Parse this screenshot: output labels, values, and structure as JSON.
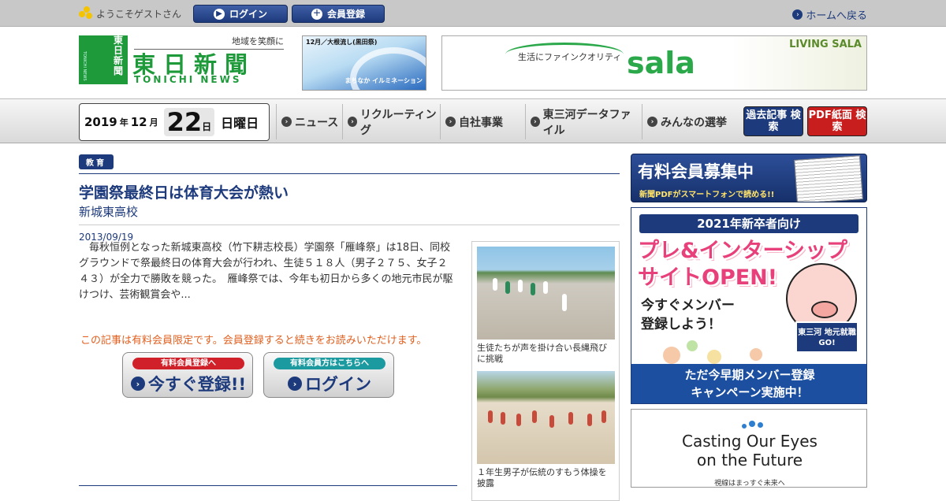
{
  "topbar": {
    "welcome": "ようこそゲストさん",
    "login_label": "ログイン",
    "register_label": "会員登録",
    "home_label": "ホームへ戻る"
  },
  "header": {
    "logo_vertical": "東日新聞",
    "logo_small": "TONICHI NEWS",
    "tagline": "地域を笑顔に",
    "logo_main": "東日新聞",
    "logo_sub": "TONICHI NEWS",
    "banner1_title": "12月／大根流し(黒田祭)",
    "banner1_sub": "まちなか イルミネーション",
    "banner2_tagline": "生活にファインクオリティ",
    "banner2_brand": "sala",
    "banner2_corner": "LIVING SALA"
  },
  "datebar": {
    "year": "2019",
    "year_suffix": "年",
    "month": "12",
    "month_suffix": "月",
    "day": "22",
    "day_suffix": "日",
    "weekday": "日曜日"
  },
  "nav": {
    "items": [
      "ニュース",
      "リクルーティング",
      "自社事業",
      "東三河データファイル",
      "みんなの選挙"
    ],
    "archive_btn": "過去記事 検索",
    "pdf_btn": "PDF紙面 検索",
    "archive_color": "#1d3a7c",
    "pdf_color": "#c81e1e"
  },
  "article": {
    "category": "教育",
    "title": "学園祭最終日は体育大会が熱い",
    "subtitle": "新城東高校",
    "date": "2013/09/19",
    "body": "毎秋恒例となった新城東高校（竹下耕志校長）学園祭「雁峰祭」は18日、同校グラウンドで祭最終日の体育大会が行われ、生徒５１８人（男子２７５、女子２４３）が全力で勝敗を競った。　雁峰祭では、今年も初日から多くの地元市民が駆けつけ、芸術観賞会や...",
    "paywall": "この記事は有料会員限定です。会員登録すると続きをお読みいただけます。",
    "signup_pill": "有料会員登録へ",
    "signup_label": "今すぐ登録!!",
    "login_pill": "有料会員方はこちらへ",
    "login_label": "ログイン",
    "signup_pill_color": "#d0202a",
    "login_pill_color": "#1b9aa0",
    "photo1_caption": "生徒たちが声を掛け合い長縄飛びに挑戦",
    "photo2_caption": "１年生男子が伝統のすもう体操を披露"
  },
  "sidebar": {
    "ad1_title": "有料会員募集中",
    "ad1_sub": "新聞PDFがスマートフォンで読める!!",
    "ad2_top": "2021年新卒者向け",
    "ad2_big1": "プレ&インターシップ",
    "ad2_big2": "サイトOPEN!",
    "ad2_reg1": "今すぐメンバー",
    "ad2_reg2": "登録しよう！",
    "ad2_tag": "東三河 地元就職GO!",
    "ad2_foot1": "ただ今早期メンバー登録",
    "ad2_foot2": "キャンペーン実施中！",
    "ad3_line1": "Casting Our Eyes",
    "ad3_line2": "on the Future",
    "ad3_sub": "視線はまっすぐ未来へ"
  }
}
